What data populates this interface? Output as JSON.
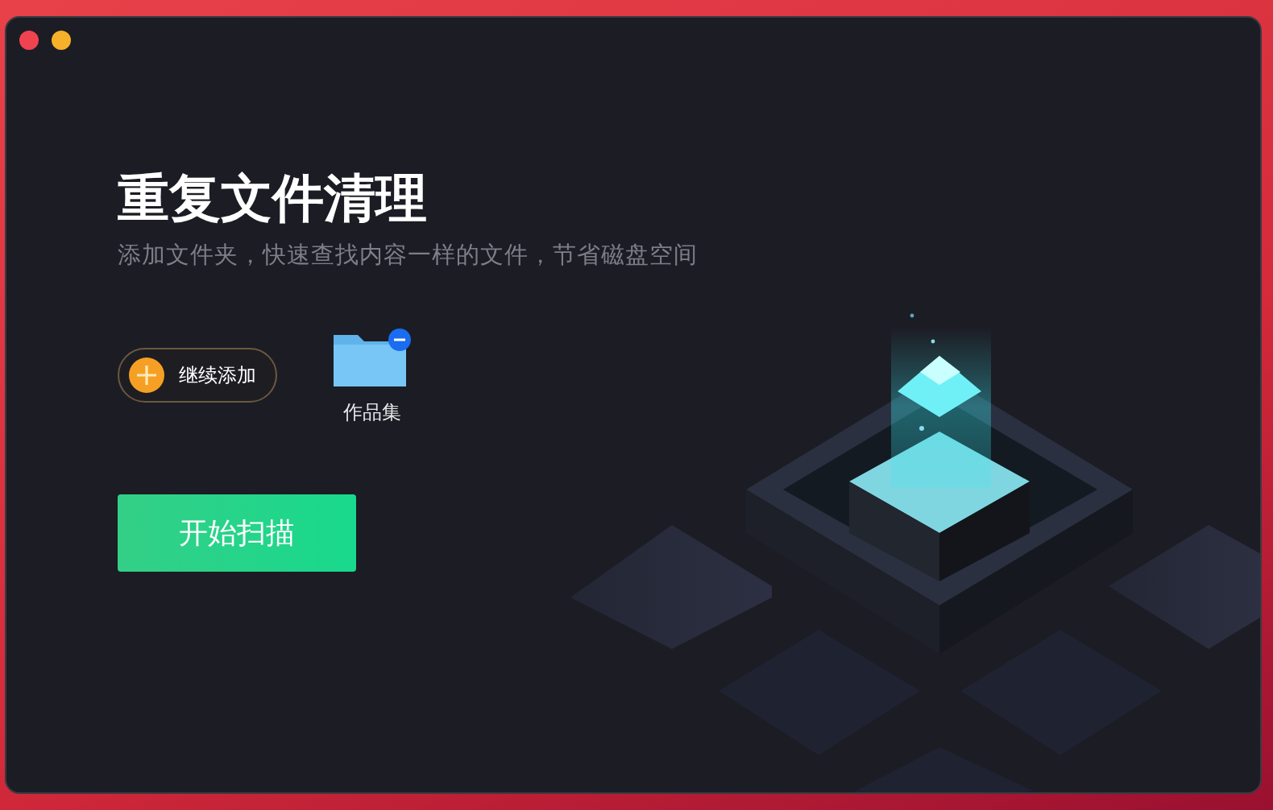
{
  "window": {
    "title": "重复文件清理",
    "subtitle": "添加文件夹，快速查找内容一样的文件，节省磁盘空间"
  },
  "add_button": {
    "label": "继续添加"
  },
  "folders": [
    {
      "label": "作品集"
    }
  ],
  "scan_button": {
    "label": "开始扫描"
  }
}
